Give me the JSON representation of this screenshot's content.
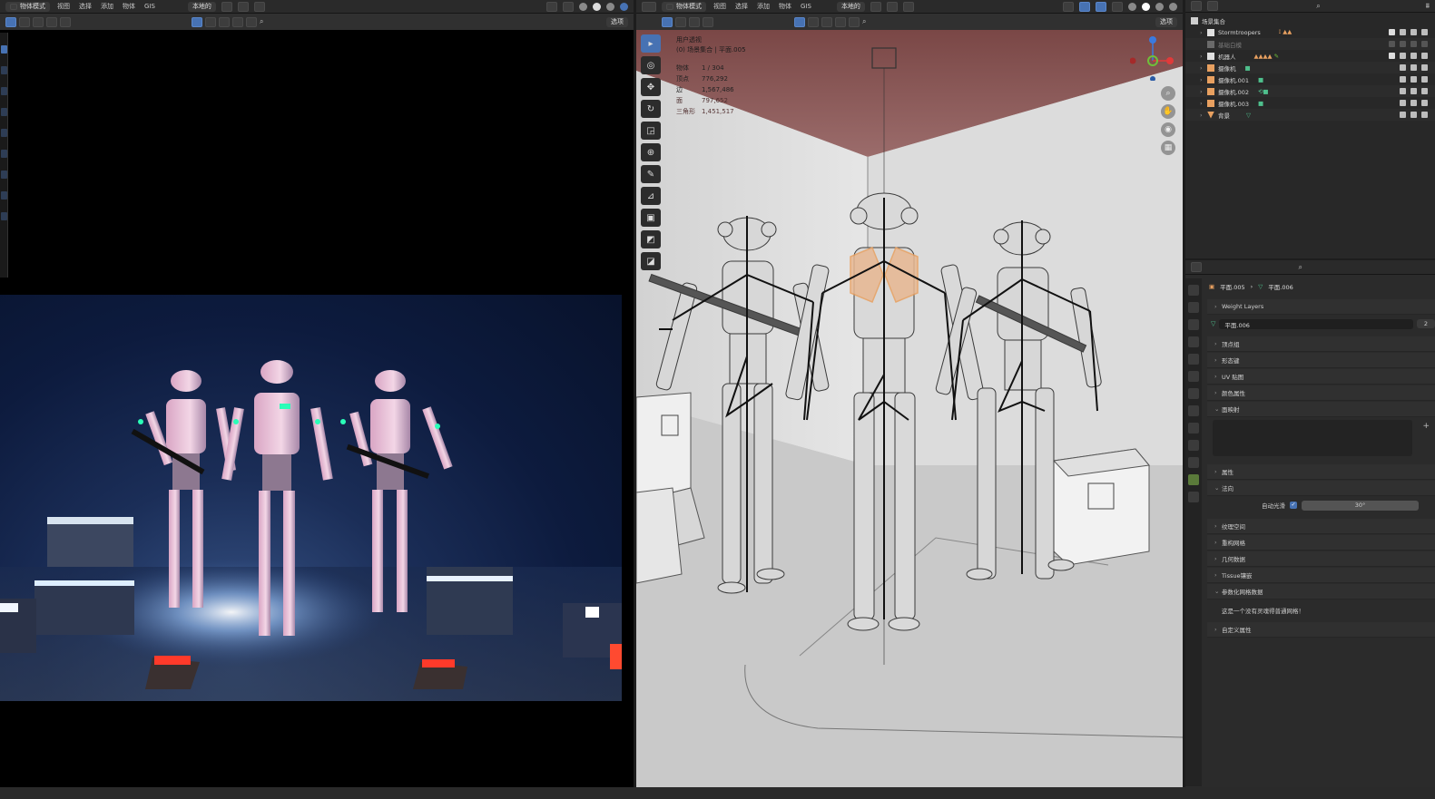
{
  "left_header": {
    "mode": "物体模式",
    "menus": [
      "视图",
      "选择",
      "添加",
      "物体",
      "GIS"
    ],
    "transform_space": "本地的"
  },
  "left_subheader": {
    "options": "选项"
  },
  "viewport_header": {
    "mode": "物体模式",
    "menus": [
      "视图",
      "选择",
      "添加",
      "物体",
      "GIS"
    ],
    "transform_space": "本地的"
  },
  "viewport_subheader": {
    "options": "选项"
  },
  "viewport_overlay": {
    "view_name": "用户透视",
    "collection_path": "(0) 场景集合 | 平面.005",
    "stats": [
      {
        "label": "物体",
        "value": "1 / 304"
      },
      {
        "label": "顶点",
        "value": "776,292"
      },
      {
        "label": "边",
        "value": "1,567,486"
      },
      {
        "label": "面",
        "value": "797,652"
      },
      {
        "label": "三角形",
        "value": "1,451,517"
      }
    ]
  },
  "outliner": {
    "root": "场景集合",
    "rows": [
      {
        "label": "Stormtroopers",
        "type": "collection"
      },
      {
        "label": "基础白模",
        "type": "collection",
        "disabled": true
      },
      {
        "label": "机器人",
        "type": "collection"
      },
      {
        "label": "摄像机",
        "type": "camera"
      },
      {
        "label": "摄像机.001",
        "type": "camera"
      },
      {
        "label": "摄像机.002",
        "type": "camera"
      },
      {
        "label": "摄像机.003",
        "type": "camera"
      },
      {
        "label": "背景",
        "type": "mesh"
      }
    ]
  },
  "properties": {
    "breadcrumb_object": "平面.005",
    "breadcrumb_data": "平面.006",
    "weight_layers": "Weight Layers",
    "mesh_name": "平面.006",
    "mesh_users": "2",
    "panels": [
      "顶点组",
      "形态键",
      "UV 贴图",
      "颜色属性",
      "面映射",
      "属性",
      "法向",
      "纹理空间",
      "重构网格",
      "几何数据",
      "Tissue镶嵌",
      "参数化网格数据",
      "自定义属性"
    ],
    "auto_smooth_label": "自动光滑",
    "auto_smooth_angle": "30°",
    "param_mesh_note": "这是一个没有灵魂得普通网格！"
  },
  "colors": {
    "accent": "#4772b3",
    "selection_orange": "#e8a060",
    "ceiling": "#6a3d3c",
    "gizmo_x": "#e03a3a",
    "gizmo_y": "#6fbf3a",
    "gizmo_z": "#3a7ae0"
  }
}
